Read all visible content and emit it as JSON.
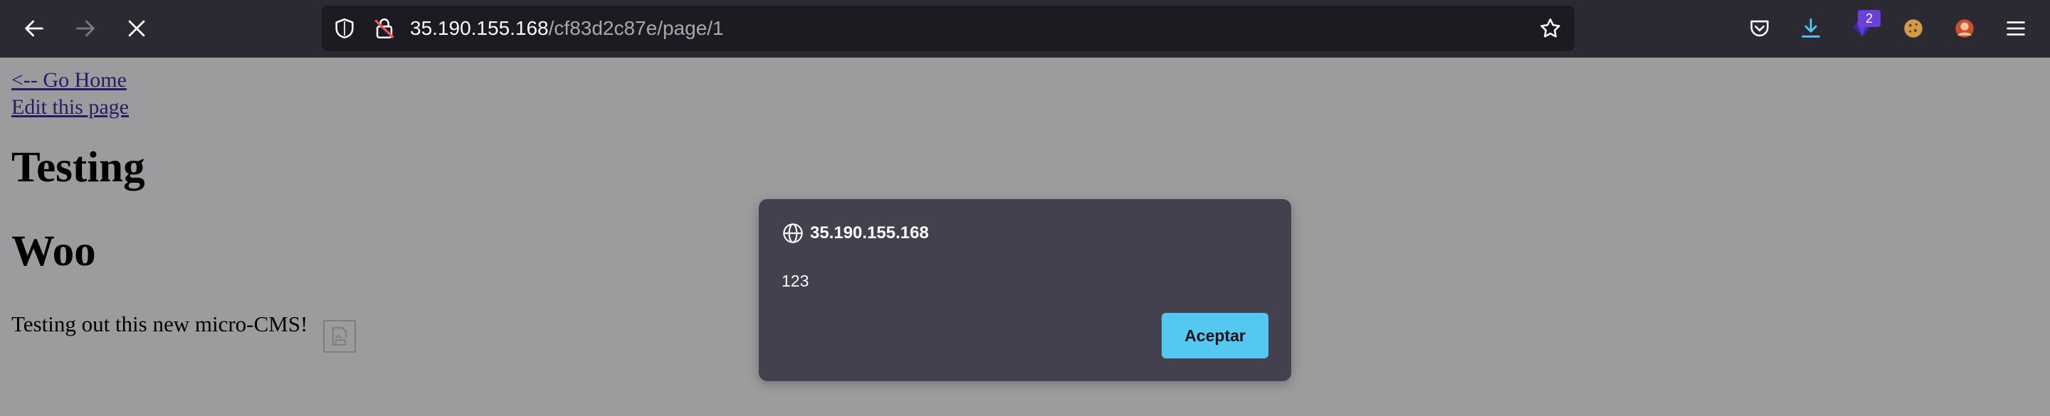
{
  "browser": {
    "url_host": "35.190.155.168",
    "url_path": "/cf83d2c87e/page/1",
    "extension_badge": "2"
  },
  "page": {
    "links": [
      "<-- Go Home",
      "Edit this page"
    ],
    "headings": [
      "Testing",
      "Woo"
    ],
    "paragraph": "Testing out this new micro-CMS!"
  },
  "dialog": {
    "origin": "35.190.155.168",
    "message": "123",
    "button_label": "Aceptar"
  },
  "colors": {
    "toolbar_bg": "#2b2a33",
    "urlbar_bg": "#1c1b22",
    "page_overlay": "#9c9c9e",
    "dialog_bg": "#42414d",
    "accent_button": "#54c8f0"
  }
}
